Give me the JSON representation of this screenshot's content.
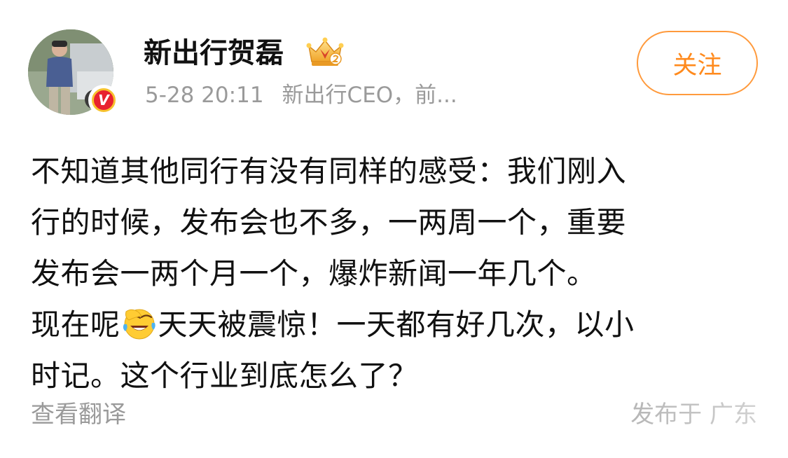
{
  "author": {
    "name": "新出行贺磊",
    "verified_mark": "V"
  },
  "meta": {
    "timestamp": "5-28 20:11",
    "description": "新出行CEO，前..."
  },
  "follow_button": {
    "label": "关注"
  },
  "post": {
    "lines": [
      "不知道其他同行有没有同样的感受：我们刚入",
      "行的时候，发布会也不多，一两周一个，重要",
      "发布会一两个月一个，爆炸新闻一年几个。",
      "",
      "时记。这个行业到底怎么了？"
    ],
    "line4_before_emoji": "现在呢",
    "line4_after_emoji": "天天被震惊！一天都有好几次，以小",
    "emoji": "laughing-crying-emoji"
  },
  "footer": {
    "translate_label": "查看翻译",
    "location_label": "发布于 广东"
  },
  "colors": {
    "accent": "#ff8a1d",
    "follow_border": "#ff9a3c",
    "muted_text": "#9a9a9a",
    "verified_red": "#e8222f",
    "verified_gold": "#f7c22e"
  }
}
